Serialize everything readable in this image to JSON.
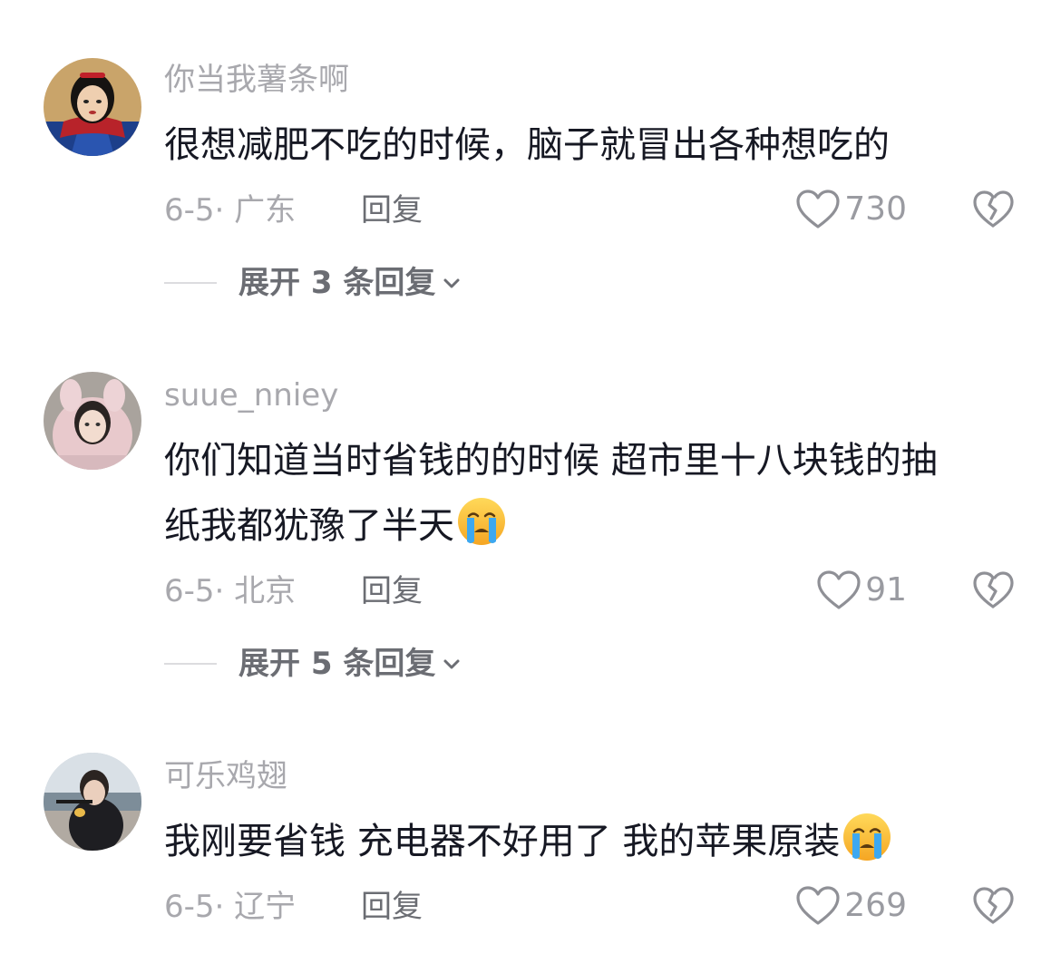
{
  "comments": [
    {
      "username": "你当我薯条啊",
      "lines": [
        "很想减肥不吃的时候，脑子就冒出各种想吃的"
      ],
      "date_location": "6-5· 广东",
      "reply_label": "回复",
      "likes": "730",
      "expand_label": "展开 3 条回复",
      "avatar_icon": "snow-white-avatar"
    },
    {
      "username": "suue_nniey",
      "lines": [
        "你们知道当时省钱的的时候 超市里十八块钱的抽",
        "纸我都犹豫了半天"
      ],
      "date_location": "6-5· 北京",
      "reply_label": "回复",
      "likes": "91",
      "expand_label": "展开 5 条回复",
      "avatar_icon": "girl-pink-hood-avatar",
      "emoji": "crying-face-emoji"
    },
    {
      "username": "可乐鸡翅",
      "lines": [
        "我刚要省钱 充电器不好用了 我的苹果原装"
      ],
      "date_location": "6-5· 辽宁",
      "reply_label": "回复",
      "likes": "269",
      "avatar_icon": "person-seaside-avatar",
      "emoji": "crying-face-emoji"
    }
  ],
  "colors": {
    "text": "#161823",
    "secondary": "#a8a8ad",
    "reply": "#6b6d73"
  }
}
